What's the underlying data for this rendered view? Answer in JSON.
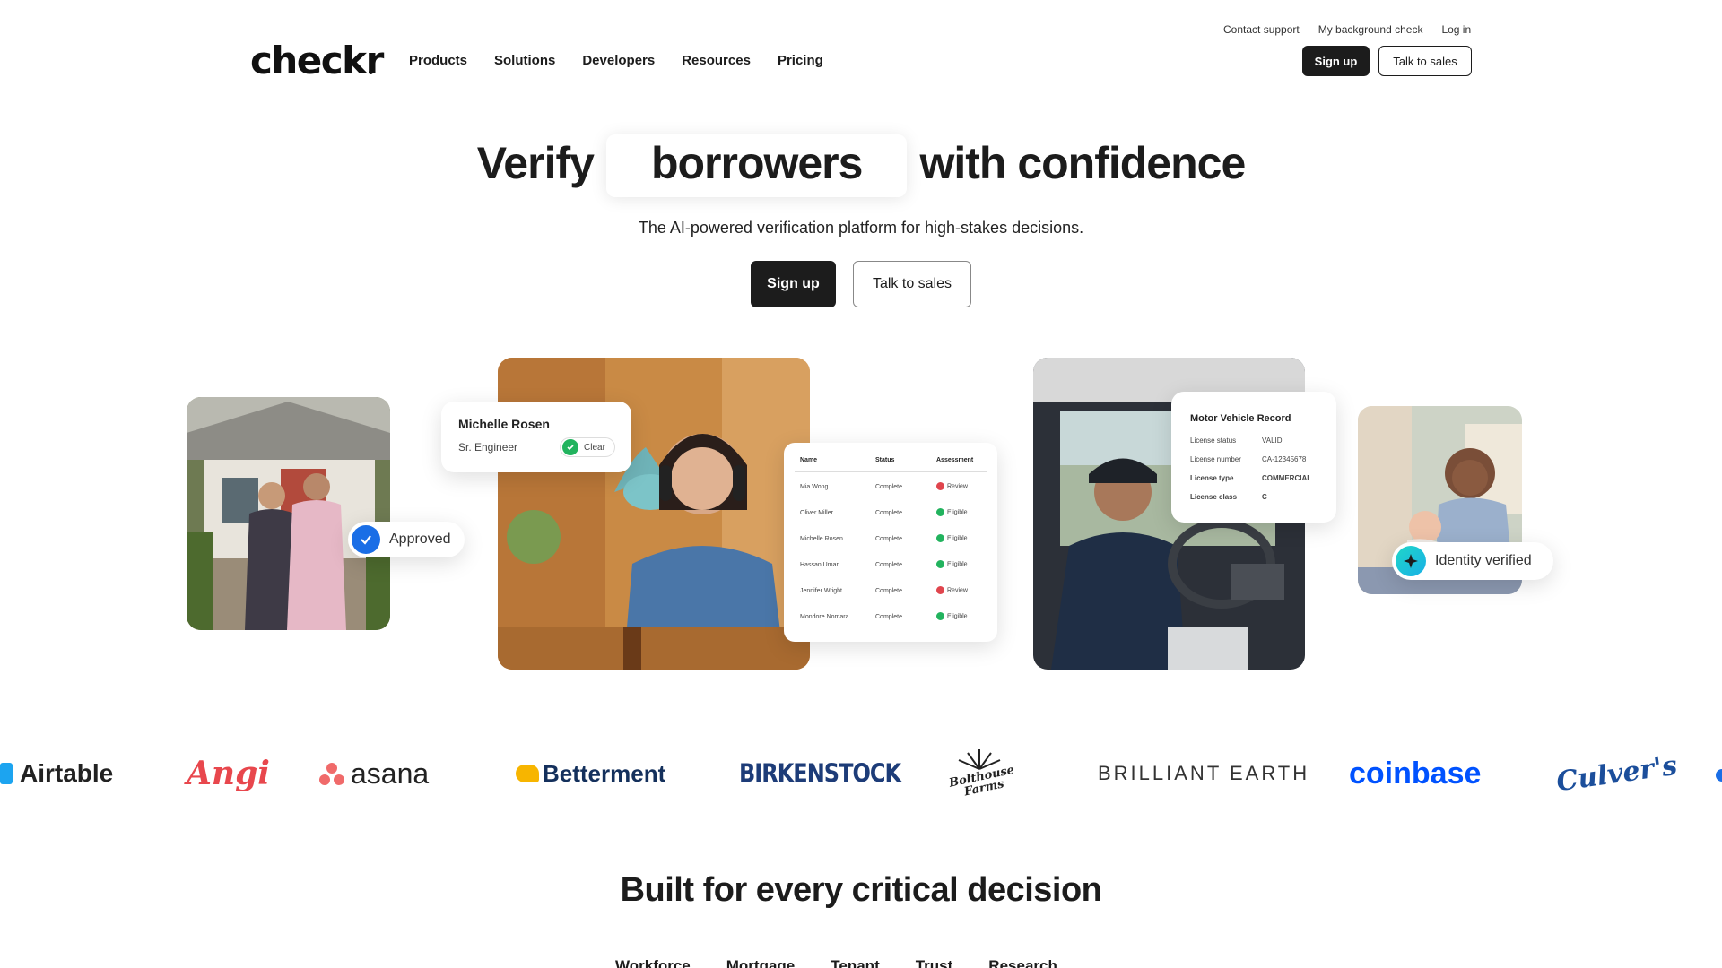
{
  "utility_nav": {
    "contact": "Contact support",
    "my_check": "My background check",
    "login": "Log in"
  },
  "brand": {
    "logo": "checkr"
  },
  "nav": {
    "items": [
      "Products",
      "Solutions",
      "Developers",
      "Resources",
      "Pricing"
    ]
  },
  "header_buttons": {
    "signup": "Sign up",
    "talk": "Talk to sales"
  },
  "hero": {
    "title_pre": "Verify",
    "title_word": "borrowers",
    "title_post": "with confidence",
    "subtitle": "The AI-powered verification platform for high-stakes decisions.",
    "signup": "Sign up",
    "talk": "Talk to sales"
  },
  "cards": {
    "approved": "Approved",
    "candidate": {
      "name": "Michelle Rosen",
      "role": "Sr. Engineer",
      "status": "Clear"
    },
    "table": {
      "headers": [
        "Name",
        "Status",
        "Assessment"
      ],
      "rows": [
        {
          "name": "Mia Wong",
          "status": "Complete",
          "assessment": "Review"
        },
        {
          "name": "Oliver Miller",
          "status": "Complete",
          "assessment": "Eligible"
        },
        {
          "name": "Michelle Rosen",
          "status": "Complete",
          "assessment": "Eligible"
        },
        {
          "name": "Hassan Umar",
          "status": "Complete",
          "assessment": "Eligible"
        },
        {
          "name": "Jennifer Wright",
          "status": "Complete",
          "assessment": "Review"
        },
        {
          "name": "Mondore Nomara",
          "status": "Complete",
          "assessment": "Eligible"
        }
      ]
    },
    "mvr": {
      "title": "Motor Vehicle Record",
      "rows": [
        {
          "label": "License status",
          "value": "VALID"
        },
        {
          "label": "License number",
          "value": "CA-12345678"
        },
        {
          "label": "License type",
          "value": "COMMERCIAL"
        },
        {
          "label": "License class",
          "value": "C"
        }
      ]
    },
    "identity": "Identity verified"
  },
  "customer_logos": [
    "Airtable",
    "Angi",
    "asana",
    "Betterment",
    "BIRKENSTOCK",
    "Bolthouse Farms",
    "BRILLIANT EARTH",
    "coinbase",
    "Culver's"
  ],
  "section": {
    "title": "Built for every critical decision"
  },
  "tabs": [
    "Workforce",
    "Mortgage",
    "Tenant",
    "Trust",
    "Research"
  ],
  "colors": {
    "primary": "#1c1c1c",
    "green": "#22b35e",
    "red": "#e0454d",
    "blue": "#1a6ee6",
    "coinbase": "#0052ff",
    "angi": "#e8474d",
    "asana": "#f06a6a"
  }
}
